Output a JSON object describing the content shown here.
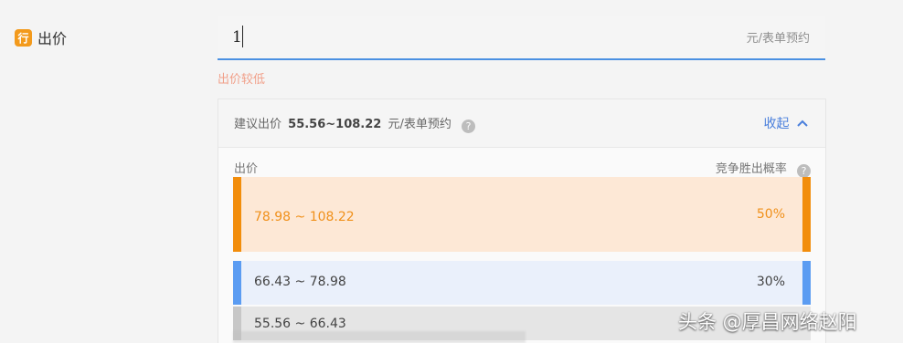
{
  "form": {
    "label": "出价",
    "badge": "行",
    "input_value": "1",
    "unit": "元/表单预约",
    "warning": "出价较低"
  },
  "suggestion": {
    "prefix": "建议出价",
    "range": "55.56~108.22",
    "unit": "元/表单预约",
    "help_icon": "?",
    "collapse": "收起",
    "collapse_icon": "chevron-up-icon"
  },
  "table": {
    "headers": {
      "price": "出价",
      "probability": "竞争胜出概率"
    },
    "rows": [
      {
        "range": "78.98 ~ 108.22",
        "pct": "50%"
      },
      {
        "range": "66.43 ~ 78.98",
        "pct": "30%"
      },
      {
        "range": "55.56 ~ 66.43",
        "pct": ""
      }
    ]
  },
  "watermark": "头条 @厚昌网络赵阳",
  "colors": {
    "orange": "#f28d0b",
    "blue": "#5b9cf2",
    "gray": "#c7c7c7",
    "link": "#4a7fdc"
  }
}
